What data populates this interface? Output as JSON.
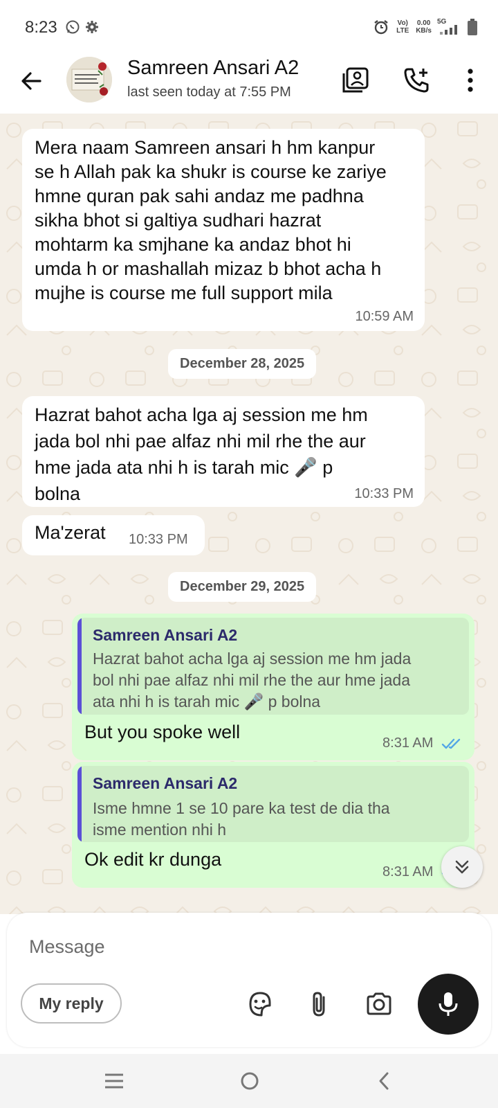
{
  "status_bar": {
    "time": "8:23",
    "network_speed_value": "0.00",
    "network_speed_unit": "KB/s",
    "signal_type": "5G",
    "volte": "Vo) LTE"
  },
  "header": {
    "contact_name": "Samreen Ansari A2",
    "last_seen": "last seen today at 7:55 PM",
    "icons": [
      "back-arrow-icon",
      "contact-card-icon",
      "add-call-icon",
      "more-vert-icon"
    ]
  },
  "messages": [
    {
      "direction": "in",
      "lines": [
        "Mera naam Samreen ansari h hm kanpur",
        "se h Allah pak ka shukr is course ke zariye",
        "hmne quran pak sahi andaz me padhna",
        "sikha bhot si galtiya sudhari hazrat",
        "mohtarm ka smjhane ka andaz bhot hi",
        "umda h or mashallah mizaz b bhot acha h",
        "mujhe is course me full support mila"
      ],
      "time": "10:59 AM"
    },
    {
      "date_divider": "December 28, 2025"
    },
    {
      "direction": "in",
      "lines": [
        "Hazrat bahot acha lga aj session me hm",
        "jada bol nhi pae alfaz nhi mil rhe the aur",
        "hme jada ata nhi h is tarah mic 🎤 p",
        "bolna"
      ],
      "time": "10:33 PM"
    },
    {
      "direction": "in",
      "lines": [
        "Ma'zerat"
      ],
      "time": "10:33 PM"
    },
    {
      "date_divider": "December 29, 2025"
    },
    {
      "direction": "out",
      "quote_name": "Samreen Ansari A2",
      "quote_lines": [
        "Hazrat bahot acha lga aj session me hm jada",
        "bol nhi pae alfaz nhi mil rhe the aur hme jada",
        "ata nhi h is tarah mic 🎤 p bolna"
      ],
      "text": "But you spoke well",
      "time": "8:31 AM",
      "read": true
    },
    {
      "direction": "out",
      "quote_name": "Samreen Ansari A2",
      "quote_lines": [
        "Isme hmne 1 se 10 pare ka test de dia tha",
        "isme mention nhi h"
      ],
      "text": "Ok edit kr dunga",
      "time": "8:31 AM",
      "read": true
    }
  ],
  "composer": {
    "placeholder": "Message",
    "my_reply_label": "My reply",
    "icons": [
      "sticker-icon",
      "attach-icon",
      "camera-icon",
      "mic-icon"
    ]
  },
  "nav_bar": {
    "icons": [
      "recents-icon",
      "home-icon",
      "back-icon"
    ]
  },
  "colors": {
    "chat_bg": "#f4efe7",
    "incoming_bubble": "#ffffff",
    "outgoing_bubble": "#d9fdd3",
    "read_ticks": "#53a6e6",
    "quote_bar": "#5b4fd6"
  }
}
